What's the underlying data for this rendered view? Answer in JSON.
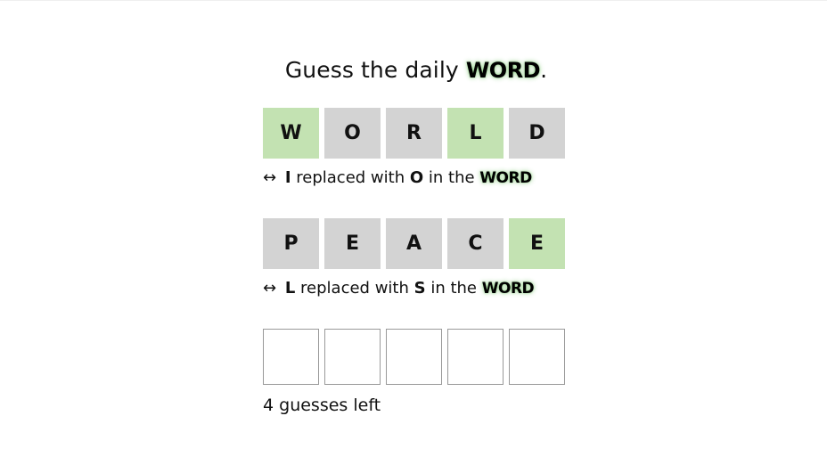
{
  "header": {
    "title_prefix": "Guess the daily ",
    "title_brand": "WORD",
    "title_suffix": "."
  },
  "colors": {
    "correct": "#c3e2b2",
    "absent": "#d3d3d3",
    "empty_border": "#999999",
    "brand_glow": "#96d28c"
  },
  "guesses": [
    {
      "letters": [
        "W",
        "O",
        "R",
        "L",
        "D"
      ],
      "states": [
        "correct",
        "absent",
        "absent",
        "correct",
        "absent"
      ],
      "hint": {
        "arrow": "↔",
        "from": "I",
        "middle": "replaced with",
        "to": "O",
        "suffix": "in the",
        "brand": "WORD"
      }
    },
    {
      "letters": [
        "P",
        "E",
        "A",
        "C",
        "E"
      ],
      "states": [
        "absent",
        "absent",
        "absent",
        "absent",
        "correct"
      ],
      "hint": {
        "arrow": "↔",
        "from": "L",
        "middle": "replaced with",
        "to": "S",
        "suffix": "in the",
        "brand": "WORD"
      }
    }
  ],
  "current_row": {
    "letters": [
      "",
      "",
      "",
      "",
      ""
    ]
  },
  "status": {
    "guesses_left": "4 guesses left"
  }
}
